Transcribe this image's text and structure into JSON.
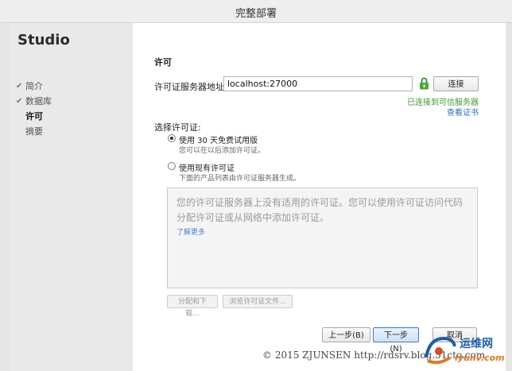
{
  "window": {
    "title": "完整部署"
  },
  "sidebar": {
    "brand": "Studio",
    "items": [
      {
        "label": "简介",
        "completed": true,
        "active": false
      },
      {
        "label": "数据库",
        "completed": true,
        "active": false
      },
      {
        "label": "许可",
        "completed": false,
        "active": true
      },
      {
        "label": "摘要",
        "completed": false,
        "active": false
      }
    ]
  },
  "main": {
    "heading": "许可",
    "server": {
      "label": "许可证服务器地址:",
      "value": "localhost:27000",
      "connect_label": "连接",
      "status": "已连接到可信服务器",
      "view_cert": "查看证书"
    },
    "choose_label": "选择许可证:",
    "options": [
      {
        "label": "使用 30 天免费试用版",
        "desc": "您可以在以后添加许可证。",
        "selected": true
      },
      {
        "label": "使用现有许可证",
        "desc": "下面的产品列表由许可证服务器生成。",
        "selected": false
      }
    ],
    "empty_message": "您的许可证服务器上没有适用的许可证。您可以使用许可证访问代码分配许可证或从网络中添加许可证。",
    "learn_more": "了解更多",
    "assign_label": "分配和下载...",
    "browse_label": "浏览许可证文件..."
  },
  "footer": {
    "back_label": "上一步(B)",
    "next_label": "下一步(N)",
    "cancel_label": "取消"
  },
  "watermark": {
    "copyright": "© 2015 ZJUNSEN http://rdsrv.blog.51cto.com",
    "site_name": "运维网",
    "site_url": "iyunv.com"
  },
  "colors": {
    "accent": "#3b78c9",
    "success": "#3a9a2a",
    "link": "#2a6fc9",
    "sidebar_bg": "#e9e9e9"
  }
}
